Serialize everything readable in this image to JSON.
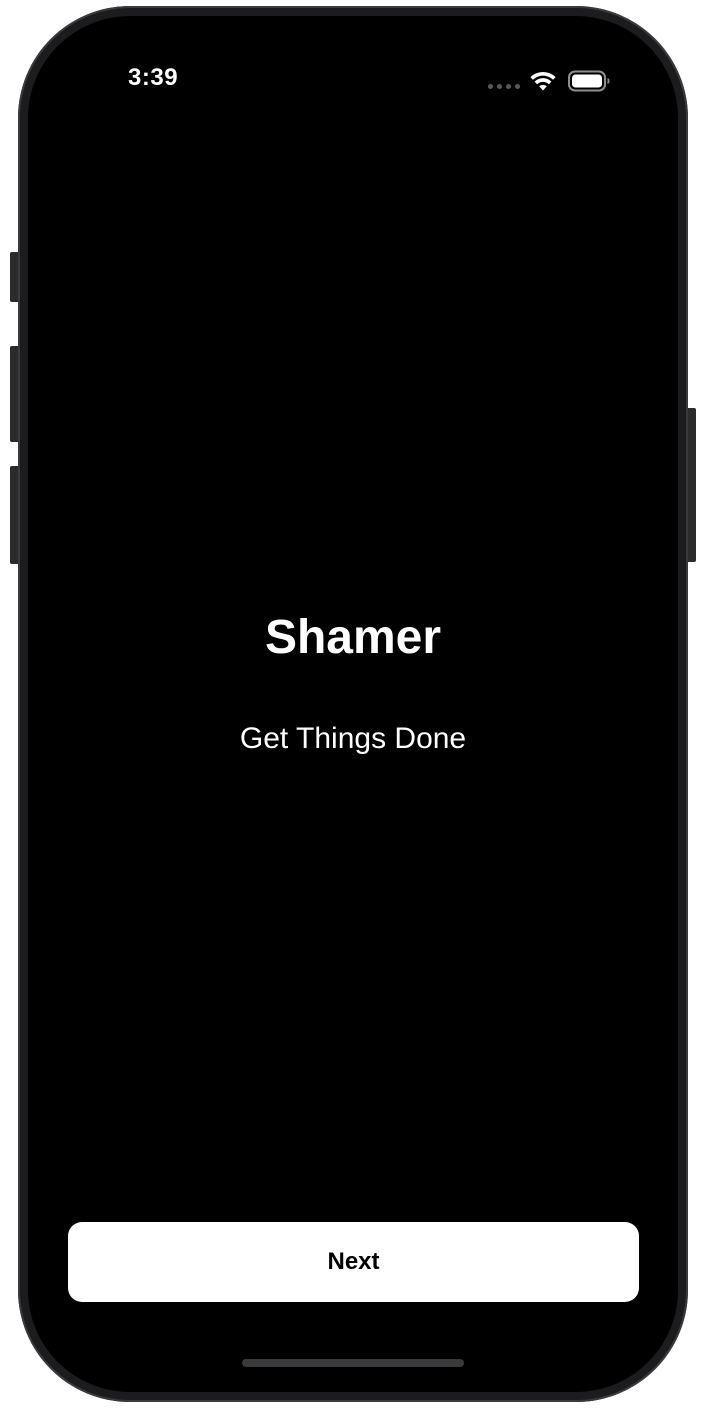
{
  "status_bar": {
    "time": "3:39",
    "icons": [
      "signal-dots-icon",
      "wifi-icon",
      "battery-icon"
    ]
  },
  "onboarding": {
    "title": "Shamer",
    "subtitle": "Get Things Done"
  },
  "actions": {
    "next_label": "Next"
  },
  "colors": {
    "background": "#000000",
    "text": "#ffffff",
    "button_background": "#ffffff",
    "button_text": "#000000",
    "device_frame": "#1c1c1e"
  }
}
